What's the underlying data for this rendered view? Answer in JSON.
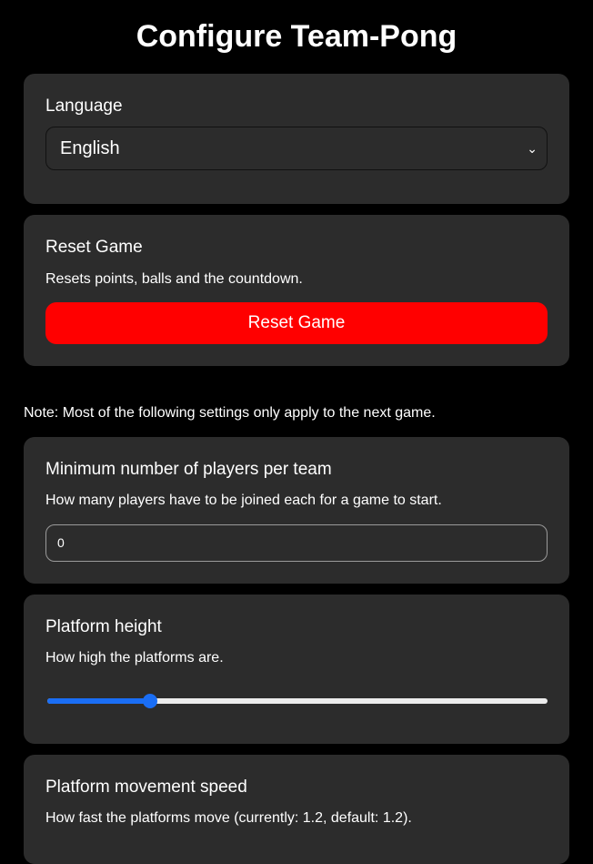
{
  "page": {
    "title": "Configure Team-Pong",
    "note": "Note: Most of the following settings only apply to the next game."
  },
  "language": {
    "label": "Language",
    "selected": "English"
  },
  "reset": {
    "title": "Reset Game",
    "description": "Resets points, balls and the countdown.",
    "button_label": "Reset Game",
    "button_color": "#ff0000"
  },
  "min_players": {
    "title": "Minimum number of players per team",
    "description": "How many players have to be joined each for a game to start.",
    "value": "0"
  },
  "platform_height": {
    "title": "Platform height",
    "description": "How high the platforms are.",
    "slider_fraction": 0.206,
    "accent_color": "#1a6ef5"
  },
  "platform_speed": {
    "title": "Platform movement speed",
    "description": "How fast the platforms move (currently: 1.2, default: 1.2)."
  }
}
